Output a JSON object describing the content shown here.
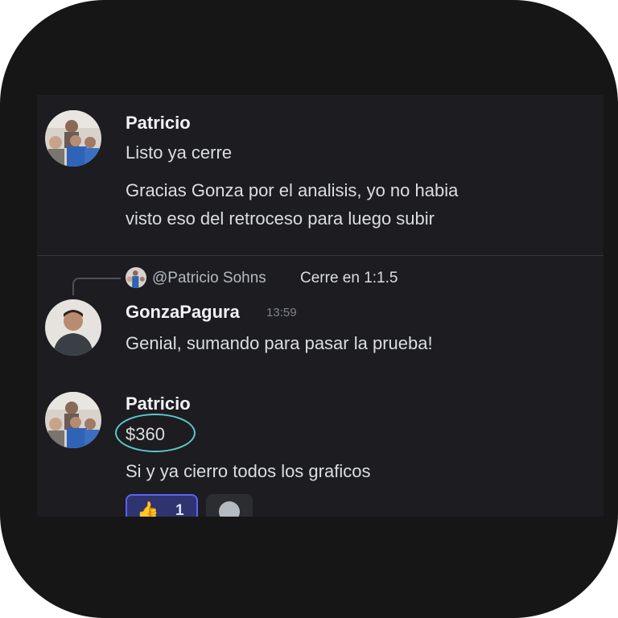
{
  "colors": {
    "background": "#1c1c21",
    "author": "#f2f3f5",
    "message": "#dbdee1",
    "timestamp": "#80848e",
    "highlight_circle": "#5fc8c8",
    "reaction_border": "#5865f2"
  },
  "messages": [
    {
      "author": "Patricio",
      "avatar": "family-photo-avatar",
      "lines": [
        "Listo ya cerre",
        "Gracias Gonza por el analisis, yo no habia",
        "visto eso del retroceso para luego subir"
      ]
    },
    {
      "reply_to": {
        "mention": "@Patricio Sohns",
        "text": "Cerre en 1:1.5"
      },
      "author": "GonzaPagura",
      "timestamp": "13:59",
      "avatar": "man-portrait-avatar",
      "lines": [
        "Genial, sumando para pasar la prueba!"
      ]
    },
    {
      "author": "Patricio",
      "avatar": "family-photo-avatar",
      "lines": [
        "$360",
        "Si y ya cierro todos los graficos"
      ],
      "reactions": [
        {
          "emoji": "👍",
          "icon": "thumbs-up-icon",
          "count": "1"
        }
      ]
    }
  ]
}
